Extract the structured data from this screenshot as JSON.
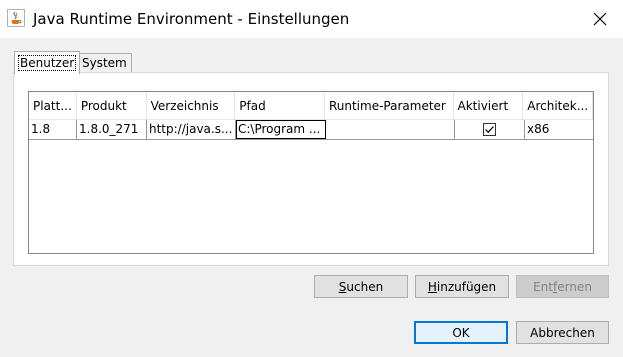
{
  "window": {
    "title": "Java Runtime Environment - Einstellungen",
    "app_icon": "java-cup-icon",
    "close_icon": "close-icon"
  },
  "tabs": [
    {
      "label": "Benutzer",
      "active": true
    },
    {
      "label": "System",
      "active": false
    }
  ],
  "table": {
    "columns": [
      "Platt...",
      "Produkt",
      "Verzeichnis",
      "Pfad",
      "Runtime-Parameter",
      "Aktiviert",
      "Architek..."
    ],
    "rows": [
      {
        "platform": "1.8",
        "product": "1.8.0_271",
        "location": "http://java.s...",
        "path": "C:\\Program ...",
        "runtime_params": "",
        "enabled": true,
        "arch": "x86"
      }
    ]
  },
  "buttons": {
    "search": {
      "prefix": "",
      "mnemonic": "S",
      "rest": "uchen"
    },
    "add": {
      "prefix": "",
      "mnemonic": "H",
      "rest": "inzufügen"
    },
    "remove": {
      "prefix": "Ent",
      "mnemonic": "f",
      "rest": "ernen"
    },
    "ok": "OK",
    "cancel": "Abbrechen"
  }
}
